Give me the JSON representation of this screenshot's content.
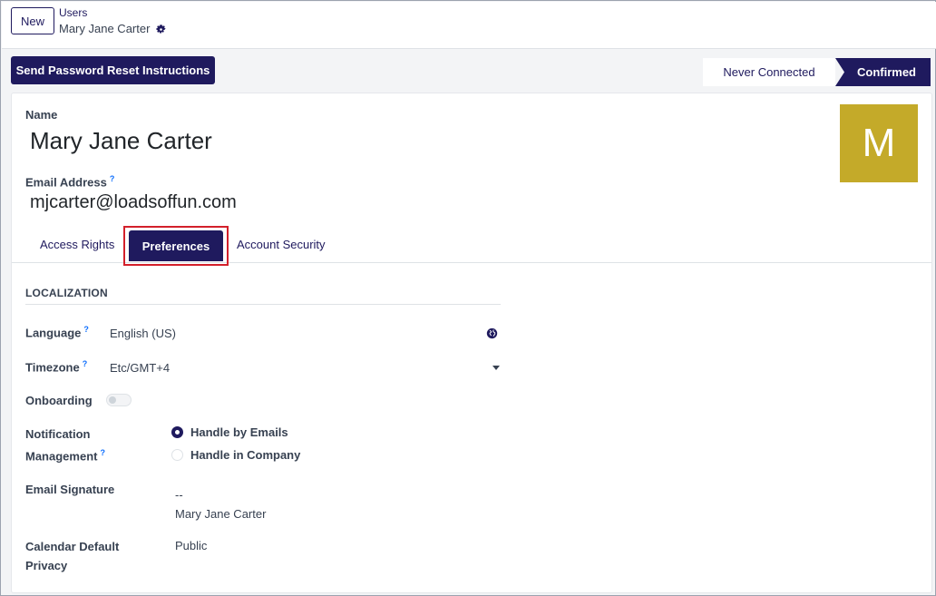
{
  "control_panel": {
    "new_label": "New",
    "breadcrumb_parent": "Users",
    "breadcrumb_current": "Mary Jane Carter"
  },
  "actions": {
    "reset_password_label": "Send Password Reset Instructions"
  },
  "status": {
    "never_connected": "Never Connected",
    "confirmed": "Confirmed"
  },
  "user": {
    "name_label": "Name",
    "name": "Mary Jane Carter",
    "email_label": "Email Address",
    "email_help": "?",
    "email": "mjcarter@loadsoffun.com",
    "avatar_letter": "M",
    "avatar_color": "#c4aa29"
  },
  "tabs": [
    {
      "label": "Access Rights"
    },
    {
      "label": "Preferences"
    },
    {
      "label": "Account Security"
    }
  ],
  "localization": {
    "section_title": "LOCALIZATION",
    "language_label": "Language",
    "language_help": "?",
    "language_value": "English (US)",
    "timezone_label": "Timezone",
    "timezone_help": "?",
    "timezone_value": "Etc/GMT+4",
    "onboarding_label": "Onboarding",
    "notification_label_line1": "Notification",
    "notification_label_line2": "Management",
    "notification_help": "?",
    "notification_options": [
      {
        "label": "Handle by Emails",
        "selected": true
      },
      {
        "label": "Handle in Company",
        "selected": false
      }
    ],
    "signature_label": "Email Signature",
    "signature_line1": "--",
    "signature_line2": "Mary Jane Carter",
    "calendar_label_line1": "Calendar Default",
    "calendar_label_line2": "Privacy",
    "calendar_value": "Public"
  },
  "colors": {
    "primary": "#1f1a5e",
    "highlight_outline": "#d3202b"
  }
}
